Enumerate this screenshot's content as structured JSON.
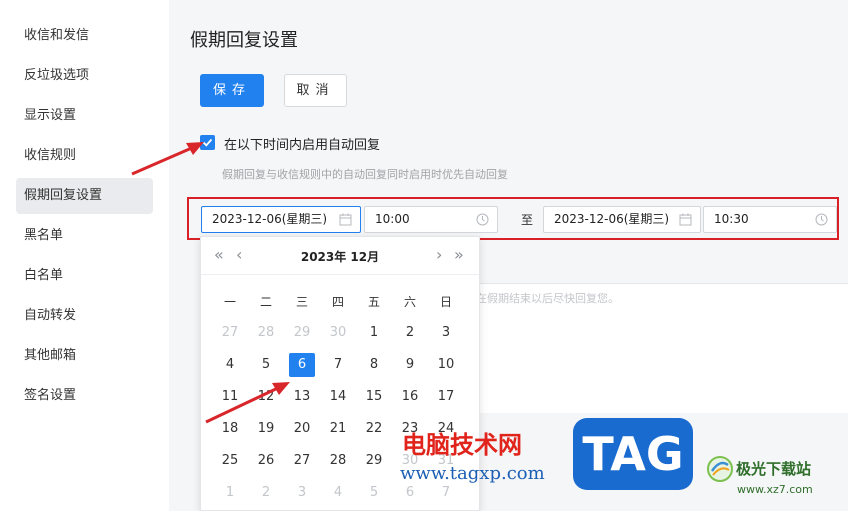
{
  "sidebar": {
    "items": [
      {
        "label": "收信和发信"
      },
      {
        "label": "反垃圾选项"
      },
      {
        "label": "显示设置"
      },
      {
        "label": "收信规则"
      },
      {
        "label": "假期回复设置",
        "active": true
      },
      {
        "label": "黑名单"
      },
      {
        "label": "白名单"
      },
      {
        "label": "自动转发"
      },
      {
        "label": "其他邮箱"
      },
      {
        "label": "签名设置"
      }
    ]
  },
  "main": {
    "title": "假期回复设置",
    "save_label": "保存",
    "cancel_label": "取消",
    "checkbox_checked": true,
    "checkbox_label": "在以下时间内启用自动回复",
    "hint": "假期回复与收信规则中的自动回复同时启用时优先自动回复",
    "range": {
      "start_date": "2023-12-06(星期三)",
      "start_time": "10:00",
      "separator": "至",
      "end_date": "2023-12-06(星期三)",
      "end_time": "10:30"
    },
    "reply_text_visible": "复。我将在假期结束以后尽快回复您。"
  },
  "calendar": {
    "title": "2023年  12月",
    "prev_year": "«",
    "prev_month": "‹",
    "next_month": "›",
    "next_year": "»",
    "weekdays": [
      "一",
      "二",
      "三",
      "四",
      "五",
      "六",
      "日"
    ],
    "weeks": [
      [
        {
          "d": "27",
          "m": true
        },
        {
          "d": "28",
          "m": true
        },
        {
          "d": "29",
          "m": true
        },
        {
          "d": "30",
          "m": true
        },
        {
          "d": "1"
        },
        {
          "d": "2"
        },
        {
          "d": "3"
        }
      ],
      [
        {
          "d": "4"
        },
        {
          "d": "5"
        },
        {
          "d": "6",
          "sel": true
        },
        {
          "d": "7"
        },
        {
          "d": "8"
        },
        {
          "d": "9"
        },
        {
          "d": "10"
        }
      ],
      [
        {
          "d": "11"
        },
        {
          "d": "12"
        },
        {
          "d": "13"
        },
        {
          "d": "14"
        },
        {
          "d": "15"
        },
        {
          "d": "16"
        },
        {
          "d": "17"
        }
      ],
      [
        {
          "d": "18"
        },
        {
          "d": "19"
        },
        {
          "d": "20"
        },
        {
          "d": "21"
        },
        {
          "d": "22"
        },
        {
          "d": "23"
        },
        {
          "d": "24"
        }
      ],
      [
        {
          "d": "25"
        },
        {
          "d": "26"
        },
        {
          "d": "27"
        },
        {
          "d": "28"
        },
        {
          "d": "29"
        },
        {
          "d": "30",
          "m": true
        },
        {
          "d": "31",
          "m": true
        }
      ],
      [
        {
          "d": "1",
          "m": true
        },
        {
          "d": "2",
          "m": true
        },
        {
          "d": "3",
          "m": true
        },
        {
          "d": "4",
          "m": true
        },
        {
          "d": "5",
          "m": true
        },
        {
          "d": "6",
          "m": true
        },
        {
          "d": "7",
          "m": true
        }
      ]
    ]
  },
  "watermark": {
    "site_name": "电脑技术网",
    "site_url": "www.tagxp.com",
    "tag_logo": "TAG",
    "jg_name": "极光下载站",
    "jg_url": "www.xz7.com"
  },
  "colors": {
    "accent": "#2181ee",
    "highlight_border": "#d92027",
    "annotation_arrow": "#d8262b"
  }
}
